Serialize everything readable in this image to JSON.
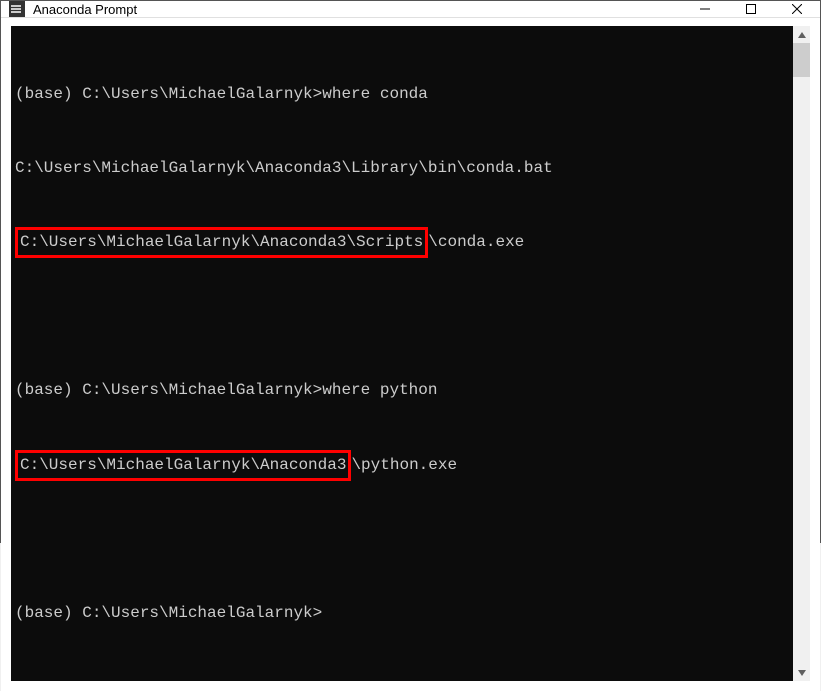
{
  "window": {
    "title": "Anaconda Prompt"
  },
  "terminal": {
    "line1_prompt": "(base) C:\\Users\\MichaelGalarnyk>",
    "line1_cmd": "where conda",
    "line2": "C:\\Users\\MichaelGalarnyk\\Anaconda3\\Library\\bin\\conda.bat",
    "line3_hl": "C:\\Users\\MichaelGalarnyk\\Anaconda3\\Scripts",
    "line3_rest": "\\conda.exe",
    "line4_prompt": "(base) C:\\Users\\MichaelGalarnyk>",
    "line4_cmd": "where python",
    "line5_hl": "C:\\Users\\MichaelGalarnyk\\Anaconda3",
    "line5_rest": "\\python.exe",
    "line6_prompt": "(base) C:\\Users\\MichaelGalarnyk>"
  }
}
